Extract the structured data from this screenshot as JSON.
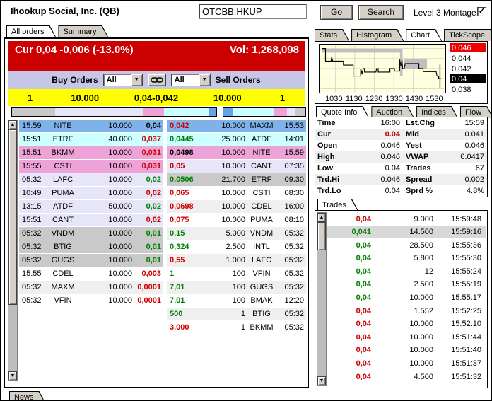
{
  "header": {
    "title": "Ihookup Social, Inc. (QB)",
    "symbol_value": "OTCBB:HKUP",
    "go_label": "Go",
    "search_label": "Search",
    "level3_label": "Level 3 Montage",
    "level3_checked": "✓"
  },
  "montage_tabs": [
    {
      "label": "All orders",
      "active": true
    },
    {
      "label": "Summary",
      "active": false
    }
  ],
  "panel_tabs": [
    {
      "label": "Stats",
      "active": false
    },
    {
      "label": "Histogram",
      "active": false
    },
    {
      "label": "Chart",
      "active": true
    },
    {
      "label": "TickScope",
      "active": false
    }
  ],
  "quote_tabs": [
    {
      "label": "Quote Info",
      "active": true
    },
    {
      "label": "Auction",
      "active": false
    },
    {
      "label": "Indices",
      "active": false
    },
    {
      "label": "Flow",
      "active": false
    }
  ],
  "trades_tab_label": "Trades",
  "news_tab_label": "News",
  "banner": {
    "cur": "Cur 0,04 -0,006 (-13.0%)",
    "vol": "Vol: 1,268,098"
  },
  "order_controls": {
    "buy_label": "Buy Orders",
    "buy_filter_value": "All",
    "sell_filter_value": "All",
    "sell_label": "Sell Orders",
    "link_icon": "chain-link"
  },
  "inside_market": {
    "bid_count": "1",
    "bid_size": "10.000",
    "spread": "0,04-0,042",
    "ask_size": "10.000",
    "ask_count": "1"
  },
  "palette": {
    "banner_bg": "#CC0000",
    "orders_bar_bg": "#C6C6E6",
    "inside_bg": "#FFFF00",
    "level_blue": "#7FB2E8",
    "level_cyan": "#CCFFFF",
    "level_pink": "#EDA2D8",
    "level_lav": "#E6E6F8",
    "level_gray": "#C9C9C9",
    "row_white": "#FFFFFF",
    "row_alt": "#EFEFEF",
    "depth_blue": "#66A3E8",
    "up": "#008000",
    "down": "#CC0000",
    "flat": "#000000",
    "trade_hl": "#D8D8D8",
    "chart_bg": "#FFFFDE",
    "ytick_red_bg": "#EE0000",
    "ytick_black_bg": "#000000"
  },
  "depth_bars": {
    "bid": [
      [
        "level_gray",
        21
      ],
      [
        "level_lav",
        43
      ],
      [
        "level_pink",
        10.5
      ],
      [
        "level_cyan",
        22
      ],
      [
        "depth_blue",
        3.5
      ]
    ],
    "ask": [
      [
        "depth_blue",
        12
      ],
      [
        "level_cyan",
        50
      ],
      [
        "level_pink",
        16
      ],
      [
        "level_lav",
        10
      ],
      [
        "level_gray",
        12
      ]
    ]
  },
  "bids": [
    {
      "time": "15:59",
      "mpid": "NITE",
      "size": "10.000",
      "price": "0,04",
      "dir": "flat",
      "lvl": "level_blue"
    },
    {
      "time": "15:51",
      "mpid": "ETRF",
      "size": "40.000",
      "price": "0,037",
      "dir": "down",
      "lvl": "level_cyan"
    },
    {
      "time": "15:51",
      "mpid": "BKMM",
      "size": "10.000",
      "price": "0,031",
      "dir": "down",
      "lvl": "level_pink"
    },
    {
      "time": "15:55",
      "mpid": "CSTI",
      "size": "10.000",
      "price": "0,031",
      "dir": "down",
      "lvl": "level_pink"
    },
    {
      "time": "05:32",
      "mpid": "LAFC",
      "size": "10.000",
      "price": "0,02",
      "dir": "up",
      "lvl": "level_lav"
    },
    {
      "time": "10:49",
      "mpid": "PUMA",
      "size": "10.000",
      "price": "0,02",
      "dir": "down",
      "lvl": "level_lav"
    },
    {
      "time": "13:15",
      "mpid": "ATDF",
      "size": "50.000",
      "price": "0,02",
      "dir": "up",
      "lvl": "level_lav"
    },
    {
      "time": "15:51",
      "mpid": "CANT",
      "size": "10.000",
      "price": "0,02",
      "dir": "down",
      "lvl": "level_lav"
    },
    {
      "time": "05:32",
      "mpid": "VNDM",
      "size": "10.000",
      "price": "0,01",
      "dir": "up",
      "lvl": "level_gray"
    },
    {
      "time": "05:32",
      "mpid": "BTIG",
      "size": "10.000",
      "price": "0,01",
      "dir": "up",
      "lvl": "level_gray"
    },
    {
      "time": "05:32",
      "mpid": "GUGS",
      "size": "10.000",
      "price": "0,01",
      "dir": "up",
      "lvl": "level_gray"
    },
    {
      "time": "15:55",
      "mpid": "CDEL",
      "size": "10.000",
      "price": "0,003",
      "dir": "down",
      "lvl": "row_white"
    },
    {
      "time": "05:32",
      "mpid": "MAXM",
      "size": "10.000",
      "price": "0,0001",
      "dir": "down",
      "lvl": "row_alt"
    },
    {
      "time": "05:32",
      "mpid": "VFIN",
      "size": "10.000",
      "price": "0,0001",
      "dir": "down",
      "lvl": "row_white"
    }
  ],
  "asks": [
    {
      "price": "0,042",
      "size": "10.000",
      "mpid": "MAXM",
      "time": "15:53",
      "dir": "down",
      "lvl": "level_blue"
    },
    {
      "price": "0,0445",
      "size": "25.000",
      "mpid": "ATDF",
      "time": "14:01",
      "dir": "up",
      "lvl": "level_cyan"
    },
    {
      "price": "0,0498",
      "size": "10.000",
      "mpid": "NITE",
      "time": "15:59",
      "dir": "flat",
      "lvl": "level_pink"
    },
    {
      "price": "0,05",
      "size": "10.000",
      "mpid": "CANT",
      "time": "07:35",
      "dir": "down",
      "lvl": "level_lav"
    },
    {
      "price": "0,0506",
      "size": "21.700",
      "mpid": "ETRF",
      "time": "09:30",
      "dir": "up",
      "lvl": "level_gray"
    },
    {
      "price": "0,065",
      "size": "10.000",
      "mpid": "CSTI",
      "time": "08:30",
      "dir": "down",
      "lvl": "row_white"
    },
    {
      "price": "0,0698",
      "size": "10.000",
      "mpid": "CDEL",
      "time": "16:00",
      "dir": "down",
      "lvl": "row_alt"
    },
    {
      "price": "0,075",
      "size": "10.000",
      "mpid": "PUMA",
      "time": "08:10",
      "dir": "down",
      "lvl": "row_white"
    },
    {
      "price": "0,15",
      "size": "5.000",
      "mpid": "VNDM",
      "time": "05:32",
      "dir": "up",
      "lvl": "row_alt"
    },
    {
      "price": "0,324",
      "size": "2.500",
      "mpid": "INTL",
      "time": "05:32",
      "dir": "up",
      "lvl": "row_white"
    },
    {
      "price": "0,55",
      "size": "1.000",
      "mpid": "LAFC",
      "time": "05:32",
      "dir": "down",
      "lvl": "row_alt"
    },
    {
      "price": "1",
      "size": "100",
      "mpid": "VFIN",
      "time": "05:32",
      "dir": "up",
      "lvl": "row_white"
    },
    {
      "price": "7,01",
      "size": "100",
      "mpid": "GUGS",
      "time": "05:32",
      "dir": "up",
      "lvl": "row_alt"
    },
    {
      "price": "7,01",
      "size": "100",
      "mpid": "BMAK",
      "time": "12:20",
      "dir": "up",
      "lvl": "row_white"
    },
    {
      "price": "500",
      "size": "1",
      "mpid": "BTIG",
      "time": "05:32",
      "dir": "up",
      "lvl": "row_alt"
    },
    {
      "price": "3.000",
      "size": "1",
      "mpid": "BKMM",
      "time": "05:32",
      "dir": "down",
      "lvl": "row_white"
    }
  ],
  "quote_info": [
    {
      "l1": "Time",
      "v1": "16:00",
      "l2": "Lst.Chg",
      "v2": "15:59",
      "alt": false,
      "v1_red": false
    },
    {
      "l1": "Cur",
      "v1": "0.04",
      "l2": "Mid",
      "v2": "0.041",
      "alt": true,
      "v1_red": true
    },
    {
      "l1": "Open",
      "v1": "0.046",
      "l2": "Yest",
      "v2": "0.046",
      "alt": false,
      "v1_red": false
    },
    {
      "l1": "High",
      "v1": "0.046",
      "l2": "VWAP",
      "v2": "0.0417",
      "alt": true,
      "v1_red": false
    },
    {
      "l1": "Low",
      "v1": "0.04",
      "l2": "Trades",
      "v2": "67",
      "alt": false,
      "v1_red": false
    },
    {
      "l1": "Trd.Hi",
      "v1": "0.046",
      "l2": "Spread",
      "v2": "0.002",
      "alt": true,
      "v1_red": false
    },
    {
      "l1": "Trd.Lo",
      "v1": "0.04",
      "l2": "Sprd %",
      "v2": "4.8%",
      "alt": false,
      "v1_red": false
    }
  ],
  "trades": [
    {
      "price": "0,04",
      "dir": "down",
      "size": "9.000",
      "time": "15:59:48",
      "hl": false
    },
    {
      "price": "0,041",
      "dir": "up",
      "size": "14.500",
      "time": "15:59:16",
      "hl": true
    },
    {
      "price": "0,04",
      "dir": "up",
      "size": "28.500",
      "time": "15:55:36",
      "hl": false
    },
    {
      "price": "0,04",
      "dir": "up",
      "size": "5.800",
      "time": "15:55:30",
      "hl": false
    },
    {
      "price": "0,04",
      "dir": "up",
      "size": "12",
      "time": "15:55:24",
      "hl": false
    },
    {
      "price": "0,04",
      "dir": "up",
      "size": "2.500",
      "time": "15:55:19",
      "hl": false
    },
    {
      "price": "0,04",
      "dir": "up",
      "size": "10.000",
      "time": "15:55:17",
      "hl": false
    },
    {
      "price": "0,04",
      "dir": "down",
      "size": "1.552",
      "time": "15:52:25",
      "hl": false
    },
    {
      "price": "0,04",
      "dir": "down",
      "size": "10.000",
      "time": "15:52:10",
      "hl": false
    },
    {
      "price": "0,04",
      "dir": "down",
      "size": "10.000",
      "time": "15:51:44",
      "hl": false
    },
    {
      "price": "0,04",
      "dir": "down",
      "size": "10.000",
      "time": "15:51:40",
      "hl": false
    },
    {
      "price": "0,04",
      "dir": "down",
      "size": "10.000",
      "time": "15:51:37",
      "hl": false
    },
    {
      "price": "0,04",
      "dir": "down",
      "size": "4.500",
      "time": "15:51:32",
      "hl": false
    }
  ],
  "chart_data": {
    "type": "line",
    "title": "Intraday price (step line) with spread bands",
    "x_ticks": [
      1030,
      1130,
      1230,
      1330,
      1430,
      1530
    ],
    "y_ticks": [
      {
        "label": "0,046",
        "value": 0.046,
        "style": "red"
      },
      {
        "label": "0,044",
        "value": 0.044,
        "style": "plain"
      },
      {
        "label": "0,042",
        "value": 0.042,
        "style": "plain"
      },
      {
        "label": "0,04",
        "value": 0.04,
        "style": "black"
      },
      {
        "label": "0,038",
        "value": 0.038,
        "style": "plain"
      }
    ],
    "xlim_hhmm": [
      945,
      1605
    ],
    "ylim": [
      0.0372,
      0.0468
    ],
    "grid": true,
    "series": [
      {
        "name": "price",
        "points": [
          [
            950,
            0.046
          ],
          [
            1000,
            0.046
          ],
          [
            1000,
            0.0435
          ],
          [
            1017,
            0.0435
          ],
          [
            1019,
            0.0443
          ],
          [
            1022,
            0.0435
          ],
          [
            1055,
            0.0435
          ],
          [
            1055,
            0.0427
          ],
          [
            1125,
            0.0427
          ],
          [
            1125,
            0.0405
          ],
          [
            1148,
            0.0405
          ],
          [
            1148,
            0.042
          ],
          [
            1152,
            0.041
          ],
          [
            1156,
            0.042
          ],
          [
            1200,
            0.042
          ],
          [
            1200,
            0.0413
          ],
          [
            1235,
            0.0413
          ],
          [
            1237,
            0.042
          ],
          [
            1242,
            0.042
          ],
          [
            1242,
            0.0413
          ],
          [
            1318,
            0.0413
          ],
          [
            1318,
            0.042
          ],
          [
            1332,
            0.042
          ],
          [
            1332,
            0.0415
          ],
          [
            1348,
            0.0415
          ],
          [
            1348,
            0.0438
          ],
          [
            1352,
            0.0424
          ],
          [
            1355,
            0.0438
          ],
          [
            1357,
            0.042
          ],
          [
            1402,
            0.042
          ],
          [
            1405,
            0.043
          ],
          [
            1447,
            0.043
          ],
          [
            1447,
            0.042
          ],
          [
            1500,
            0.042
          ],
          [
            1500,
            0.0414
          ],
          [
            1540,
            0.0414
          ],
          [
            1543,
            0.0405
          ],
          [
            1548,
            0.0405
          ],
          [
            1548,
            0.04
          ],
          [
            1556,
            0.04
          ]
        ]
      }
    ],
    "spread_bands": [
      [
        948,
        1352,
        0.0452,
        0.046
      ],
      [
        1349,
        1357,
        0.0405,
        0.046
      ],
      [
        1402,
        1512,
        0.042,
        0.044
      ],
      [
        1549,
        1554,
        0.038,
        0.0428
      ]
    ]
  }
}
